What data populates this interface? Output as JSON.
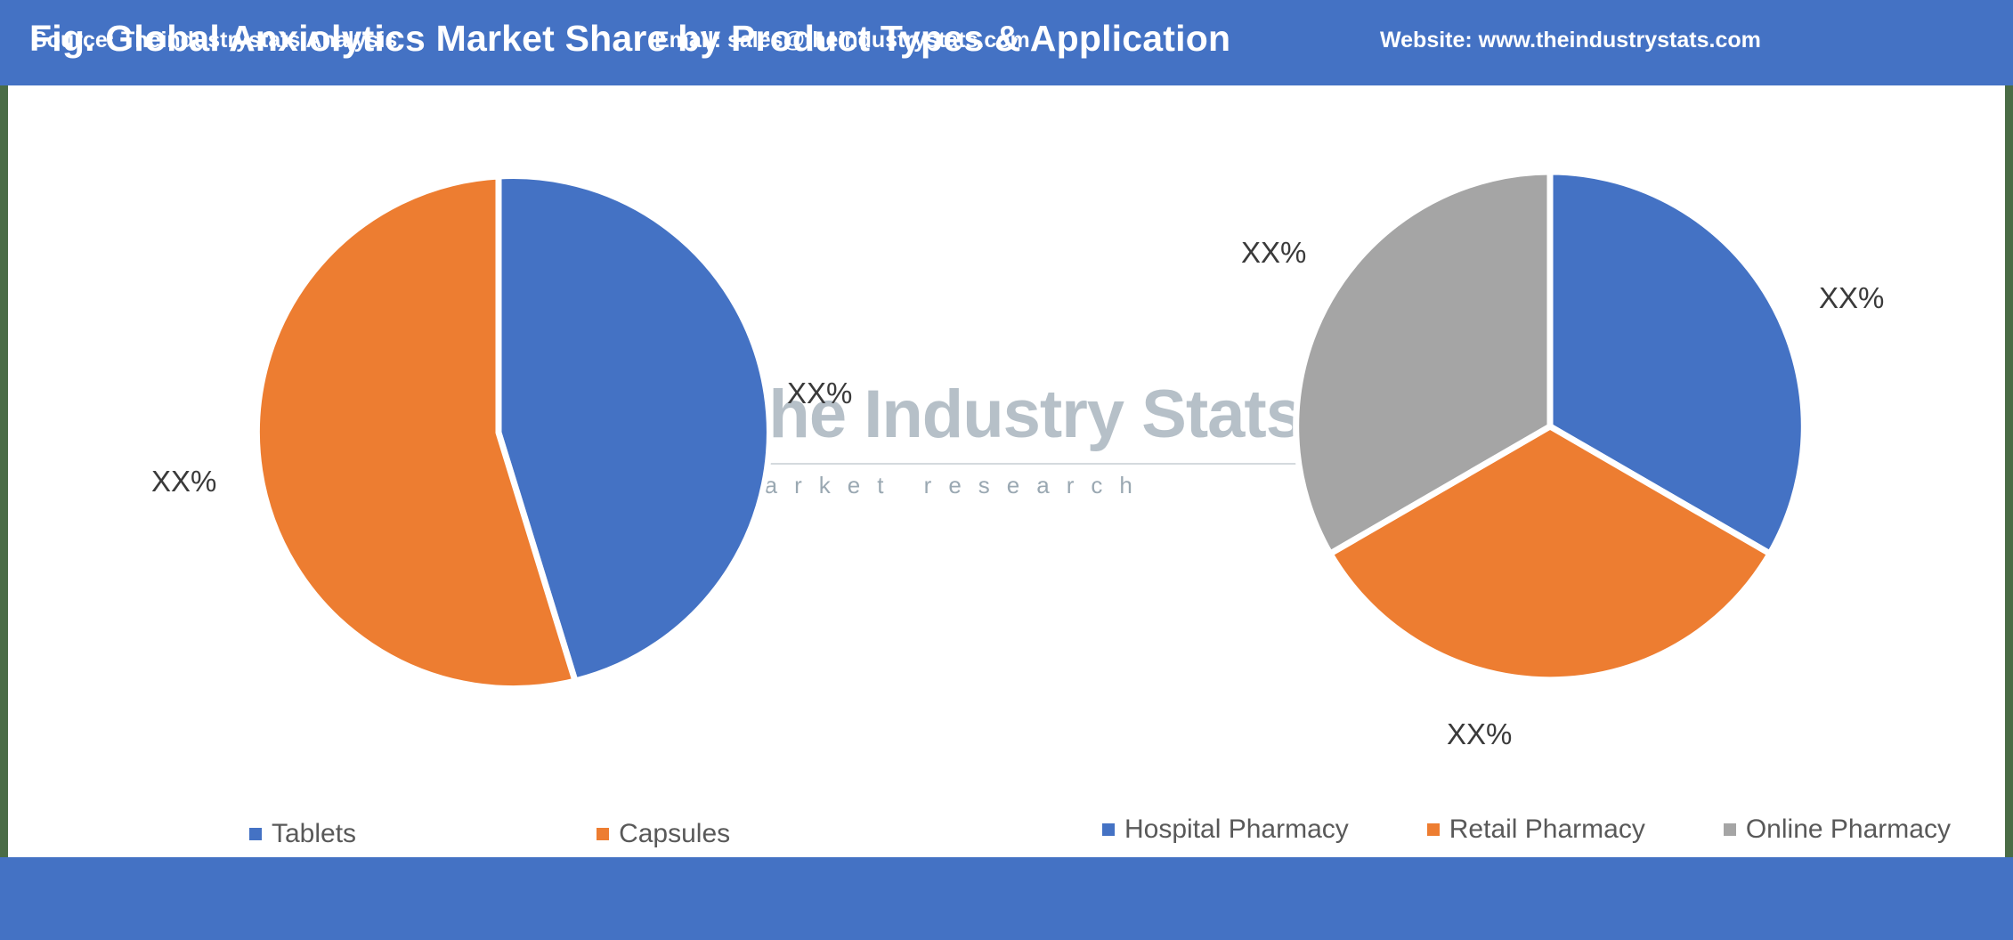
{
  "header": {
    "title": "Fig. Global Anxiolytics Market Share by Product Types & Application",
    "bg_color": "#4472C4"
  },
  "watermark": {
    "brand": "The Industry Stats",
    "tagline": "market research",
    "logo_icon": "gear-bar-chart-wrench-logo"
  },
  "footer": {
    "source": "Source: Theindustrystats Analysis",
    "email": "Email: sales@theindustrystats.com",
    "website": "Website: www.theindustrystats.com",
    "bg_color": "#4472C4"
  },
  "labels": {
    "left_blue": "XX%",
    "left_orange": "XX%",
    "right_blue": "XX%",
    "right_orange": "XX%",
    "right_gray": "XX%"
  },
  "colors": {
    "blue": "#4472C4",
    "orange": "#ED7D31",
    "gray": "#A5A5A5",
    "accent_green": "#4A6C46",
    "legend_text": "#595959"
  },
  "chart_data": [
    {
      "type": "pie",
      "title": "Product Types",
      "categories": [
        "Tablets",
        "Capsules"
      ],
      "values": [
        45,
        55
      ],
      "value_labels": [
        "XX%",
        "XX%"
      ],
      "colors": [
        "#4472C4",
        "#ED7D31"
      ],
      "legend_position": "bottom",
      "start_angle_deg": 0,
      "direction": "clockwise",
      "note": "Exact percentages masked as XX% in source figure; slice geometry read from pixels."
    },
    {
      "type": "pie",
      "title": "Application",
      "categories": [
        "Hospital Pharmacy",
        "Retail Pharmacy",
        "Online Pharmacy"
      ],
      "values": [
        33.3,
        33.3,
        33.4
      ],
      "value_labels": [
        "XX%",
        "XX%",
        "XX%"
      ],
      "colors": [
        "#4472C4",
        "#ED7D31",
        "#A5A5A5"
      ],
      "legend_position": "bottom",
      "start_angle_deg": 0,
      "direction": "clockwise",
      "note": "Exact percentages masked as XX% in source figure; slices are an even three-way split."
    }
  ],
  "legends": {
    "left": [
      {
        "label": "Tablets",
        "color": "#4472C4"
      },
      {
        "label": "Capsules",
        "color": "#ED7D31"
      }
    ],
    "right": [
      {
        "label": "Hospital Pharmacy",
        "color": "#4472C4"
      },
      {
        "label": "Retail Pharmacy",
        "color": "#ED7D31"
      },
      {
        "label": "Online Pharmacy",
        "color": "#A5A5A5"
      }
    ]
  }
}
